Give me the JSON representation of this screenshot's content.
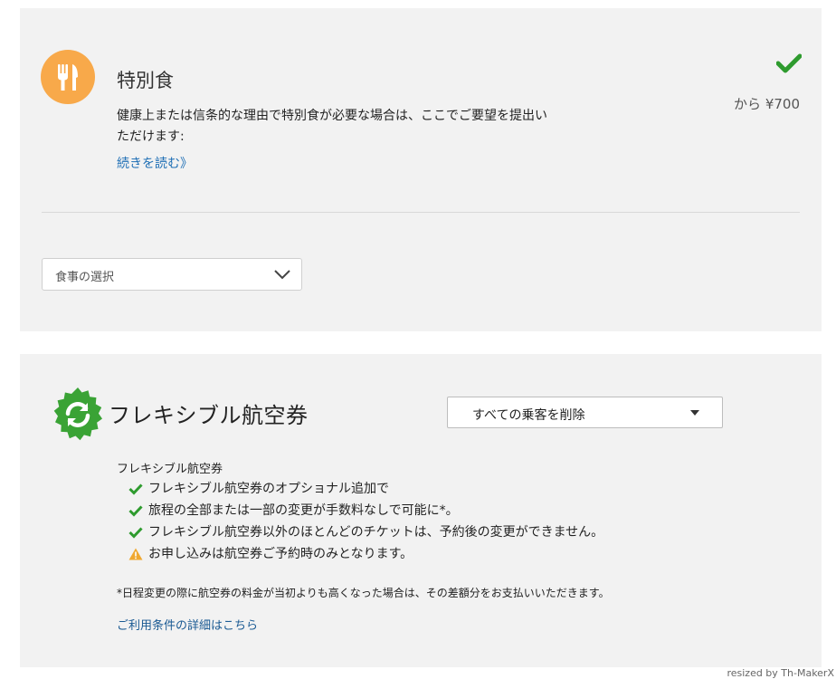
{
  "meal": {
    "title": "特別食",
    "description": "健康上または信条的な理由で特別食が必要な場合は、ここでご要望を提出いただけます:",
    "read_more": "続きを読む》",
    "price": "から ¥700",
    "select_label": "食事の選択",
    "icons": {
      "meal": "fork-knife-icon",
      "check": "checkmark-icon",
      "chevron": "chevron-down-icon"
    },
    "colors": {
      "icon_bg": "#f8a94a",
      "check": "#2e9b2e",
      "link": "#1f6fb5"
    }
  },
  "flex": {
    "title": "フレキシブル航空券",
    "select_label": "すべての乗客を削除",
    "subheading": "フレキシブル航空券",
    "features": [
      {
        "icon": "check",
        "text": "フレキシブル航空券のオプショナル追加で"
      },
      {
        "icon": "check",
        "text": "旅程の全部または一部の変更が手数料なしで可能に*。"
      },
      {
        "icon": "check",
        "text": "フレキシブル航空券以外のほとんどのチケットは、予約後の変更ができません。"
      },
      {
        "icon": "warning",
        "text": "お申し込みは航空券ご予約時のみとなります。"
      }
    ],
    "footnote": "*日程変更の際に航空券の料金が当初よりも高くなった場合は、その差額分をお支払いいただきます。",
    "terms_link": "ご利用条件の詳細はこちら",
    "icons": {
      "badge": "refresh-badge-icon",
      "caret": "caret-down-icon"
    },
    "colors": {
      "badge": "#3aa335",
      "warning": "#f0a830"
    }
  },
  "watermark": "resized by Th-MakerX"
}
